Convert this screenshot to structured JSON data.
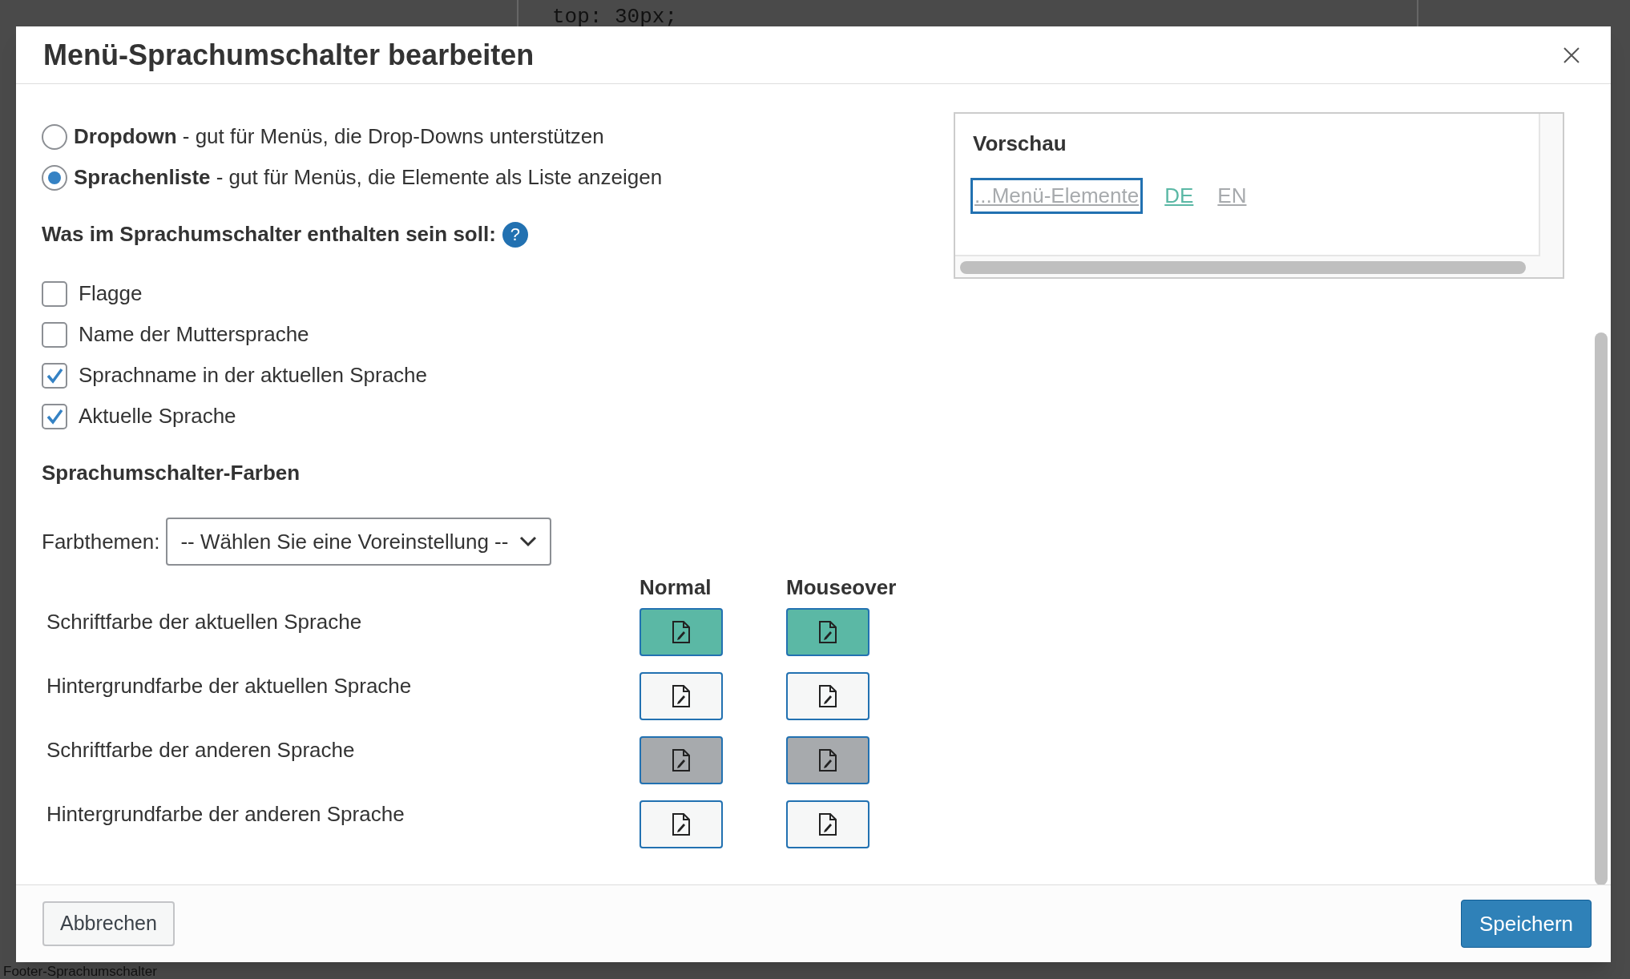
{
  "background": {
    "code_line": "top: 30px;",
    "footer_heading": "Footer-Sprachumschalter"
  },
  "dialog": {
    "title": "Menü-Sprachumschalter bearbeiten",
    "style_options": [
      {
        "label": "**Dropdown** - gut für Menüs, die Drop-Downs unterstützen",
        "selected": false
      },
      {
        "label": "**Sprachenliste** - gut für Menüs, die Elemente als Liste anzeigen",
        "selected": true
      }
    ],
    "contents_heading": "Was im Sprachumschalter enthalten sein soll:",
    "contents_help": "?",
    "contents": [
      {
        "label": "Flagge",
        "checked": false
      },
      {
        "label": "Name der Muttersprache",
        "checked": false
      },
      {
        "label": "Sprachname in der aktuellen Sprache",
        "checked": true
      },
      {
        "label": "Aktuelle Sprache",
        "checked": true
      }
    ],
    "colors_heading": "Sprachumschalter-Farben",
    "theme_label": "Farbthemen:",
    "theme_value": "-- Wählen Sie eine Voreinstellung --",
    "color_columns": [
      "Normal",
      "Mouseover"
    ],
    "color_rows": [
      {
        "label": "Schriftfarbe der aktuellen Sprache",
        "swatches": [
          {
            "color": "#5bb8a5"
          },
          {
            "color": "#5bb8a5"
          }
        ]
      },
      {
        "label": "Hintergrundfarbe der aktuellen Sprache",
        "swatches": [
          {
            "color": "#f6f7f7"
          },
          {
            "color": "#f6f7f7"
          }
        ]
      },
      {
        "label": "Schriftfarbe der anderen Sprache",
        "swatches": [
          {
            "color": "#a7aaad"
          },
          {
            "color": "#a7aaad"
          }
        ]
      },
      {
        "label": "Hintergrundfarbe der anderen Sprache",
        "swatches": [
          {
            "color": "#f6f7f7"
          },
          {
            "color": "#f6f7f7"
          }
        ]
      }
    ],
    "preview": {
      "title": "Vorschau",
      "items": [
        {
          "text": "...Menü-Elemente",
          "color": "#a7aaad",
          "focused": true
        },
        {
          "text": "DE",
          "color": "#5bb8a5",
          "focused": false
        },
        {
          "text": "EN",
          "color": "#a7aaad",
          "focused": false
        }
      ]
    },
    "cancel_button": "Abbrechen",
    "save_button": "Speichern"
  }
}
